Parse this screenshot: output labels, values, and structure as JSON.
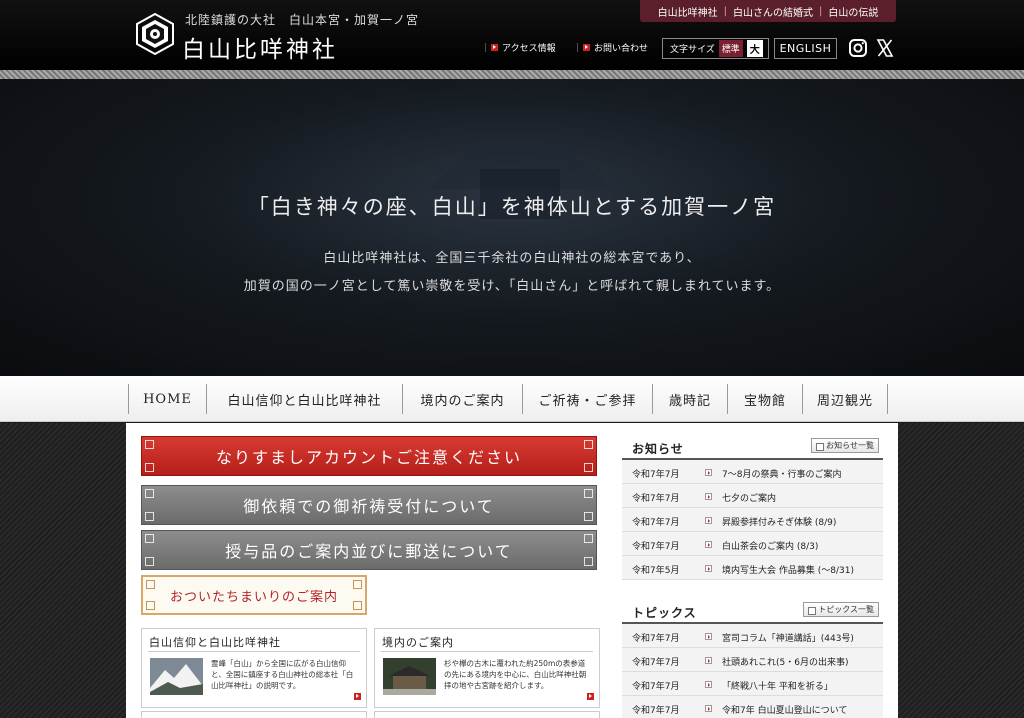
{
  "header": {
    "tagline": "北陸鎮護の大社　白山本宮・加賀一ノ宮",
    "site_name": "白山比咩神社",
    "top_links": [
      "白山比咩神社",
      "白山さんの結婚式",
      "白山の伝説"
    ],
    "access_label": "アクセス情報",
    "contact_label": "お問い合わせ",
    "fontsize_label": "文字サイズ",
    "fontsize_standard": "標準",
    "fontsize_large": "大",
    "english_label": "ENGLISH",
    "social_icons": [
      "instagram-icon",
      "x-icon"
    ]
  },
  "hero": {
    "title": "「白き神々の座、白山」を神体山とする加賀一ノ宮",
    "body_line1": "白山比咩神社は、全国三千余社の白山神社の総本宮であり、",
    "body_line2": "加賀の国の一ノ宮として篤い崇敬を受け、「白山さん」と呼ばれて親しまれています。"
  },
  "nav": {
    "items": [
      "HOME",
      "白山信仰と白山比咩神社",
      "境内のご案内",
      "ご祈祷・ご参拝",
      "歳時記",
      "宝物館",
      "周辺観光"
    ]
  },
  "banners": {
    "warning": "なりすましアカウントご注意ください",
    "request": "御依頼での御祈祷受付について",
    "items": "授与品のご案内並びに郵送について",
    "monthly": "おついたちまいりのご案内"
  },
  "cards": [
    {
      "title": "白山信仰と白山比咩神社",
      "text": "霊峰「白山」から全国に広がる白山信仰と、全国に鎮座する白山神社の総本社「白山比咩神社」の説明です。"
    },
    {
      "title": "境内のご案内",
      "text": "杉や欅の古木に覆われた約250mの表参道の先にある境内を中心に、白山比咩神社朝拝の地や古宮跡を紹介します。"
    }
  ],
  "news": {
    "heading": "お知らせ",
    "all_label": "お知らせ一覧",
    "items": [
      {
        "date": "令和7年7月",
        "title": "7～8月の祭典・行事のご案内"
      },
      {
        "date": "令和7年7月",
        "title": "七夕のご案内"
      },
      {
        "date": "令和7年7月",
        "title": "昇殿参拝付みそぎ体験 (8/9)"
      },
      {
        "date": "令和7年7月",
        "title": "白山茶会のご案内 (8/3)"
      },
      {
        "date": "令和7年5月",
        "title": "境内写生大会 作品募集 (～8/31)"
      }
    ]
  },
  "topics": {
    "heading": "トピックス",
    "all_label": "トピックス一覧",
    "items": [
      {
        "date": "令和7年7月",
        "title": "宮司コラム「神道講話」(443号)"
      },
      {
        "date": "令和7年7月",
        "title": "社頭あれこれ(5・6月の出来事)"
      },
      {
        "date": "令和7年7月",
        "title": "「終戦八十年 平和を祈る」"
      },
      {
        "date": "令和7年7月",
        "title": "令和7年 白山夏山登山について"
      }
    ]
  }
}
